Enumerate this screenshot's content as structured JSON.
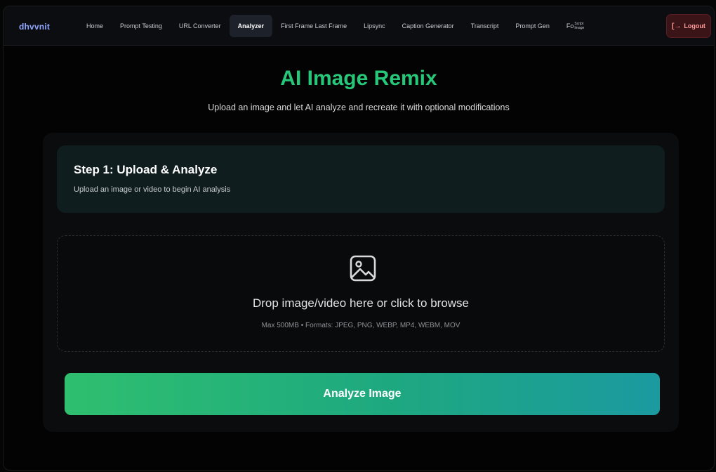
{
  "nav": {
    "logo": "dhvvnit",
    "items": [
      {
        "label": "Home",
        "active": false
      },
      {
        "label": "Prompt Testing",
        "active": false
      },
      {
        "label": "URL Converter",
        "active": false
      },
      {
        "label": "Analyzer",
        "active": true
      },
      {
        "label": "First Frame Last Frame",
        "active": false
      },
      {
        "label": "Lipsync",
        "active": false
      },
      {
        "label": "Caption Generator",
        "active": false
      },
      {
        "label": "Transcript",
        "active": false
      },
      {
        "label": "Prompt Gen",
        "active": false
      }
    ],
    "truncated_item": {
      "prefix": "Fo",
      "line1": "Script",
      "line2": "Image"
    },
    "logout_label": "Logout"
  },
  "hero": {
    "title": "AI Image Remix",
    "subtitle": "Upload an image and let AI analyze and recreate it with optional modifications"
  },
  "step": {
    "title": "Step 1: Upload & Analyze",
    "description": "Upload an image or video to begin AI analysis"
  },
  "dropzone": {
    "icon": "image-icon",
    "text": "Drop image/video here or click to browse",
    "hint": "Max 500MB • Formats: JPEG, PNG, WEBP, MP4, WEBM, MOV"
  },
  "analyze_button": {
    "label": "Analyze Image"
  },
  "colors": {
    "accent_green": "#27c77a",
    "logout_bg": "#3a1417",
    "button_gradient_start": "#2fbf6f",
    "button_gradient_end": "#1b9aa0"
  }
}
